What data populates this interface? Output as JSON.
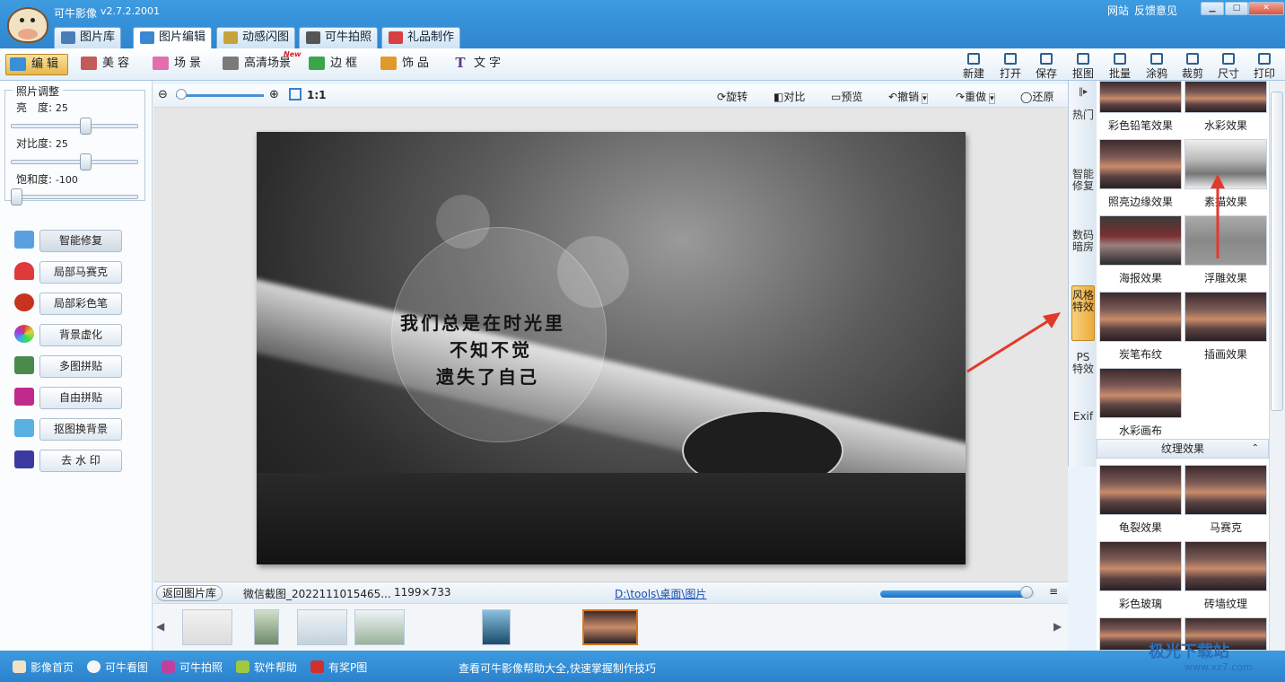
{
  "app": {
    "name": "可牛影像",
    "version": "v2.7.2.2001",
    "links": [
      "网站",
      "反馈意见"
    ]
  },
  "main_tabs": [
    {
      "label": "图片库",
      "color": "#4a7db5"
    },
    {
      "label": "图片编辑",
      "color": "#3b87d0"
    },
    {
      "label": "动感闪图",
      "color": "#c8a23a"
    },
    {
      "label": "可牛拍照",
      "color": "#555555"
    },
    {
      "label": "礼品制作",
      "color": "#d64040"
    }
  ],
  "edit_tabs": [
    {
      "label": "编辑",
      "icon": "edit-icon",
      "color": "#3a8fd6"
    },
    {
      "label": "美容",
      "icon": "face-icon",
      "color": "#c45a5a"
    },
    {
      "label": "场景",
      "icon": "scene-icon",
      "color": "#e06fb0"
    },
    {
      "label": "高清场景",
      "icon": "hd-scene-icon",
      "color": "#7a7a7a",
      "badge": "New"
    },
    {
      "label": "边框",
      "icon": "frame-icon",
      "color": "#3aa64a"
    },
    {
      "label": "饰品",
      "icon": "accessory-icon",
      "color": "#e09a2a"
    },
    {
      "label": "文字",
      "icon": "text-icon",
      "color": "#5a3a8a"
    }
  ],
  "right_tools": [
    "新建",
    "打开",
    "保存",
    "抠图",
    "批量",
    "涂鸦",
    "裁剪",
    "尺寸",
    "打印"
  ],
  "adjust": {
    "title": "照片调整",
    "brightness_label": "亮　度:",
    "brightness": "25",
    "contrast_label": "对比度:",
    "contrast": "25",
    "saturation_label": "饱和度:",
    "saturation": "-100",
    "brightness_level": 0.6,
    "contrast_level": 0.6,
    "saturation_level": 0.0
  },
  "left_buttons": [
    {
      "label": "智能修复",
      "icon": "smart-repair-icon",
      "color": "#5aa0e0"
    },
    {
      "label": "局部马赛克",
      "icon": "mosaic-icon",
      "color": "#e03a3a"
    },
    {
      "label": "局部彩色笔",
      "icon": "color-pen-icon",
      "color": "#c8321e"
    },
    {
      "label": "背景虚化",
      "icon": "blur-icon",
      "color": "#e040a0"
    },
    {
      "label": "多图拼贴",
      "icon": "collage-icon",
      "color": "#4a8a4a"
    },
    {
      "label": "自由拼贴",
      "icon": "free-collage-icon",
      "color": "#c02a8a"
    },
    {
      "label": "抠图换背景",
      "icon": "cutout-icon",
      "color": "#5ab0e0"
    },
    {
      "label": "去 水 印",
      "icon": "watermark-remove-icon",
      "color": "#3a3aa0"
    }
  ],
  "canvas_toolbar": {
    "ratio": "1:1",
    "rotate": "旋转",
    "compare": "对比",
    "preview": "预览",
    "undo": "撤销",
    "redo": "重做",
    "restore": "还原"
  },
  "photo_text": [
    "我们总是在时光里",
    "不知不觉",
    "遗失了自己"
  ],
  "status": {
    "back": "返回图片库",
    "filename": "微信截图_2022111015465...",
    "dimensions": "1199×733",
    "path": "D:\\tools\\桌面\\图片",
    "zoom_level": 0.95
  },
  "vertical_tabs": [
    "热门",
    "智能修复",
    "数码暗房",
    "风格特效",
    "PS特效",
    "Exif"
  ],
  "effects_top": [
    [
      "彩色铅笔效果",
      "水彩效果"
    ],
    [
      "照亮边缘效果",
      "素描效果"
    ],
    [
      "海报效果",
      "浮雕效果"
    ],
    [
      "炭笔布纹",
      "插画效果"
    ],
    [
      "水彩画布",
      ""
    ]
  ],
  "texture_section": "纹理效果",
  "effects_texture": [
    [
      "龟裂效果",
      "马赛克"
    ],
    [
      "彩色玻璃",
      "砖墙纹理"
    ]
  ],
  "bottom_items": [
    "影像首页",
    "可牛看图",
    "可牛拍照",
    "软件帮助",
    "有奖P图"
  ],
  "bottom_hint": "查看可牛影像帮助大全,快速掌握制作技巧",
  "watermark": {
    "text": "极光下载站",
    "url": "www.xz7.com"
  },
  "accent": "#e23a2a"
}
